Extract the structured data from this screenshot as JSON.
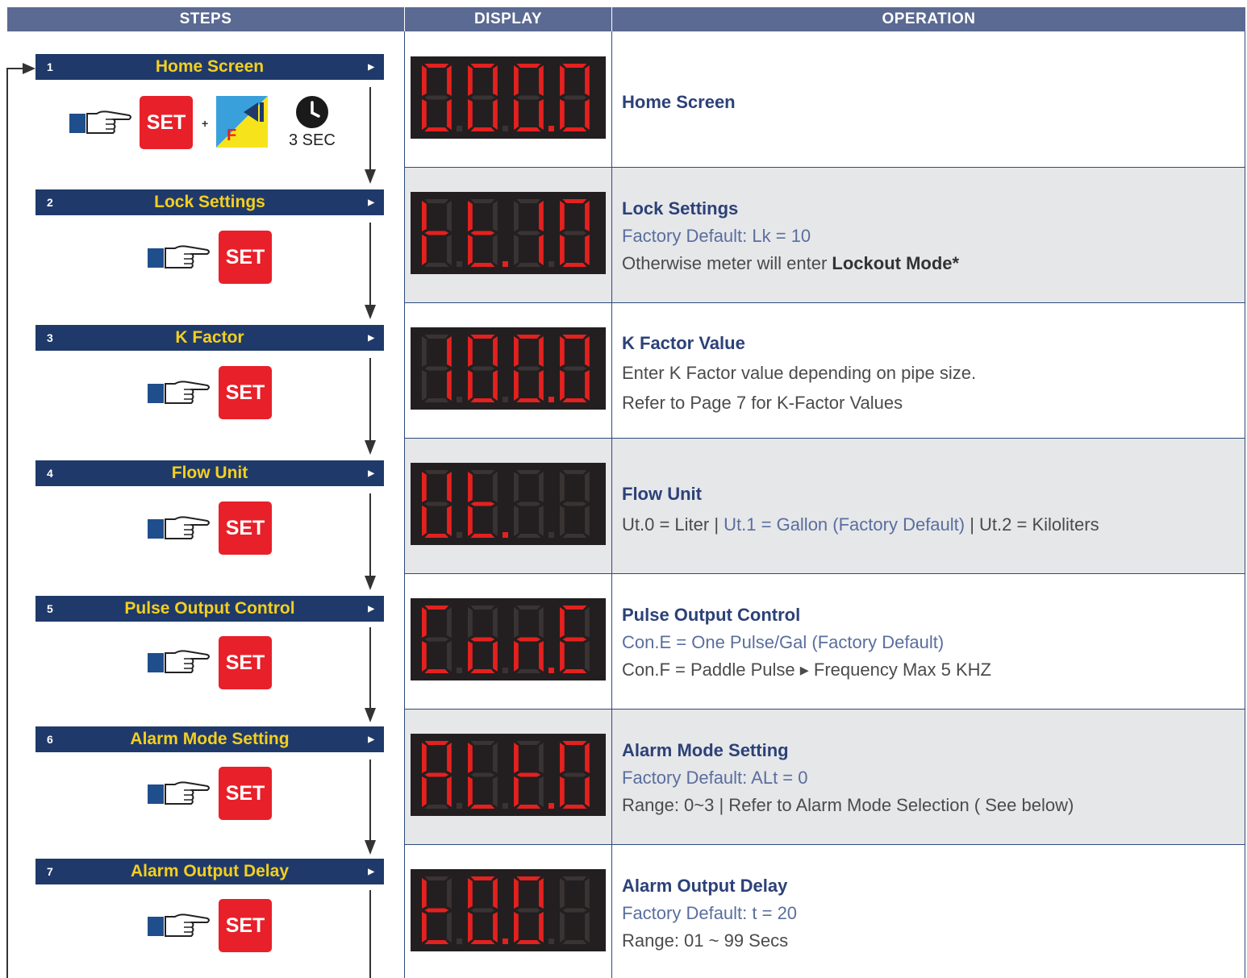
{
  "headers": {
    "steps": "STEPS",
    "display": "DISPLAY",
    "operation": "OPERATION"
  },
  "steps": [
    {
      "num": "1",
      "title": "Home Screen"
    },
    {
      "num": "2",
      "title": "Lock Settings"
    },
    {
      "num": "3",
      "title": "K Factor"
    },
    {
      "num": "4",
      "title": "Flow Unit"
    },
    {
      "num": "5",
      "title": "Pulse Output Control"
    },
    {
      "num": "6",
      "title": "Alarm Mode Setting"
    },
    {
      "num": "7",
      "title": "Alarm Output Delay"
    }
  ],
  "set_label": "SET",
  "plus_label": "+",
  "f_label": "F",
  "hold_time": "3 SEC",
  "operations": [
    {
      "title": "Home Screen"
    },
    {
      "title": "Lock Settings",
      "line1": "Factory Default: Lk = 10",
      "line2a": "Otherwise meter will enter ",
      "line2b": "Lockout Mode*"
    },
    {
      "title": "K Factor Value",
      "line1": "Enter K Factor value depending on pipe size.",
      "line2": "Refer to Page 7 for K-Factor Values"
    },
    {
      "title": "Flow Unit",
      "l1a": "Ut.0 = Liter | ",
      "l1b": "Ut.1 = Gallon (Factory Default)",
      "l1c": " |  Ut.2 = Kiloliters"
    },
    {
      "title": "Pulse Output Control",
      "line1": "Con.E = One Pulse/Gal (Factory Default)",
      "line2": "Con.F = Paddle Pulse ▸ Frequency Max 5 KHZ"
    },
    {
      "title": "Alarm Mode Setting",
      "line1": "Factory Default: ALt = 0",
      "line2": "Range: 0~3 | Refer to Alarm Mode Selection ( See below)"
    },
    {
      "title": "Alarm Output Delay",
      "line1": "Factory Default: t = 20",
      "line2": "Range: 01 ~ 99 Secs"
    }
  ],
  "displays": [
    {
      "digits": [
        "abcdef",
        "abcdef",
        "abcdef",
        "abcdef"
      ],
      "dots": [
        false,
        false,
        true,
        false
      ]
    },
    {
      "digits": [
        "efg",
        "defg",
        "bc",
        "abcdef"
      ],
      "dots": [
        false,
        true,
        false,
        false
      ]
    },
    {
      "digits": [
        "bc",
        "abcdef",
        "abcdef",
        "abcdef"
      ],
      "dots": [
        false,
        false,
        true,
        false
      ]
    },
    {
      "digits": [
        "bcdef",
        "defg",
        "",
        ""
      ],
      "dots": [
        false,
        true,
        false,
        false
      ]
    },
    {
      "digits": [
        "adef",
        "cdeg",
        "ceg",
        "adefg"
      ],
      "dots": [
        false,
        false,
        true,
        false
      ]
    },
    {
      "digits": [
        "abcefg",
        "def",
        "defg",
        "abcdef"
      ],
      "dots": [
        false,
        false,
        true,
        false
      ]
    },
    {
      "digits": [
        "defg",
        "abcdef",
        "abcdef",
        ""
      ],
      "dots": [
        false,
        true,
        false,
        false
      ]
    }
  ],
  "colors": {
    "segment_on": "#e3211f",
    "segment_off": "#3a3334",
    "step_bar": "#1f3a6a",
    "step_title": "#f4cf1f",
    "set_button": "#e8202a"
  }
}
